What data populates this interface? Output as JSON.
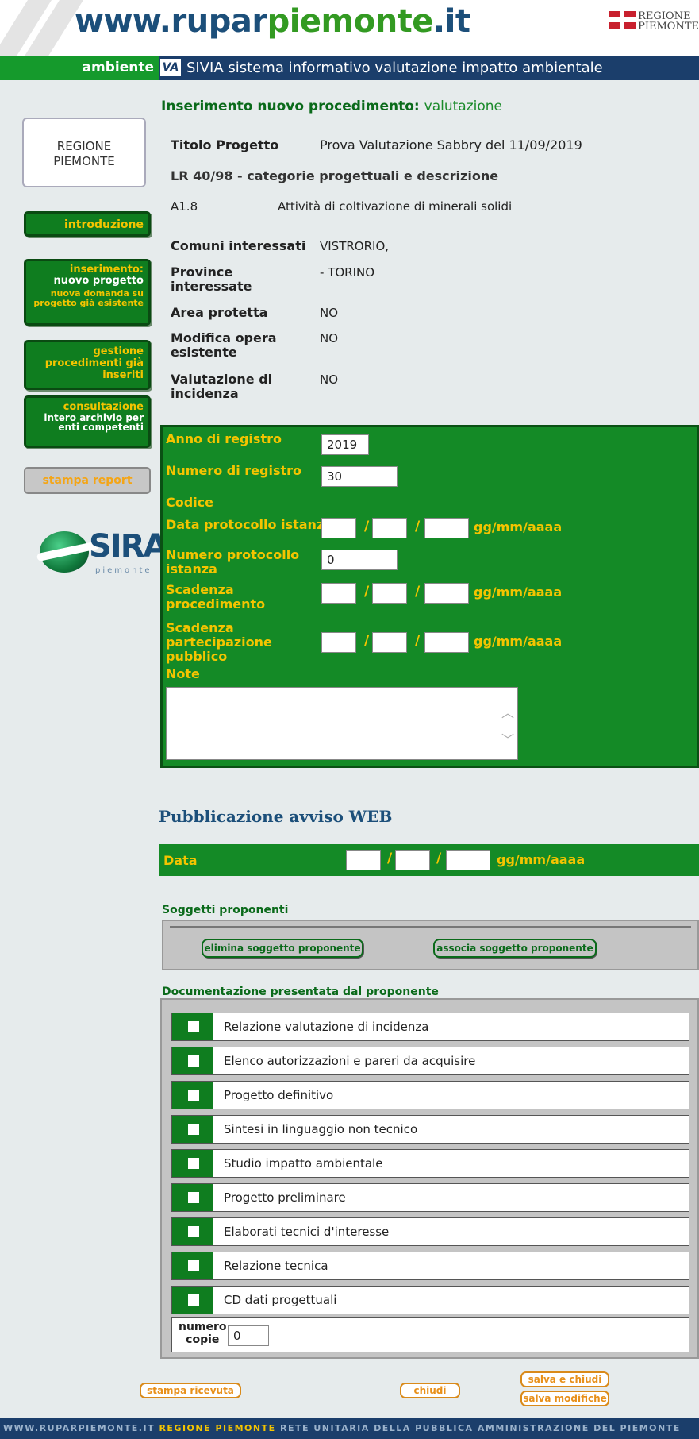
{
  "header": {
    "logo_pre": "www.",
    "logo_ru": "ru",
    "logo_par": "par",
    "logo_pie": "piemonte",
    "logo_post": ".it",
    "regione_line1": "REGIONE",
    "regione_line2": "PIEMONTE"
  },
  "nav": {
    "section": "ambiente",
    "via_logo": "VA",
    "title": "SIVIA sistema informativo valutazione impatto ambientale"
  },
  "sidebar": {
    "regione_line1": "REGIONE",
    "regione_line2": "PIEMONTE",
    "introduzione": "introduzione",
    "inserimento_title": "inserimento:",
    "inserimento_nuovo": "nuovo progetto",
    "inserimento_domanda": "nuova domanda su progetto già esistente",
    "gestione": "gestione procedimenti già inseriti",
    "consultazione_a": "consultazione",
    "consultazione_b": "intero archivio per enti competenti",
    "stampa": "stampa report",
    "sira": "SIRA",
    "sira_sub": "piemonte"
  },
  "main": {
    "heading": "Inserimento nuovo procedimento:",
    "heading_sub": "valutazione",
    "titolo_label": "Titolo Progetto",
    "titolo_value": "Prova Valutazione Sabbry del 11/09/2019",
    "lr_heading": "LR 40/98 - categorie progettuali e descrizione",
    "category_code": "A1.8",
    "category_desc": "Attività di coltivazione di minerali solidi",
    "comuni_label": "Comuni interessati",
    "comuni_value": "VISTRORIO,",
    "province_label_1": "Province",
    "province_label_2": "interessate",
    "province_value": "- TORINO",
    "area_label": "Area protetta",
    "area_value": "NO",
    "modifica_label_1": "Modifica opera",
    "modifica_label_2": "esistente",
    "modifica_value": "NO",
    "valutazione_label_1": "Valutazione di",
    "valutazione_label_2": "incidenza",
    "valutazione_value": "NO"
  },
  "registry": {
    "anno_label": "Anno di registro",
    "anno_value": "2019",
    "numero_label": "Numero di registro",
    "numero_value": "30",
    "codice_label": "Codice",
    "data_prot_label": "Data protocollo istanza",
    "date_format": "gg/mm/aaaa",
    "num_prot_label_1": "Numero protocollo",
    "num_prot_label_2": "istanza",
    "num_prot_value": "0",
    "scadenza_proc_1": "Scadenza",
    "scadenza_proc_2": "procedimento",
    "scadenza_part_1": "Scadenza",
    "scadenza_part_2": "partecipazione",
    "scadenza_part_3": "pubblico",
    "note_label": "Note",
    "slash": "/"
  },
  "web": {
    "heading": "Pubblicazione avviso WEB",
    "data_label": "Data"
  },
  "soggetti": {
    "title": "Soggetti proponenti",
    "elimina": "elimina soggetto proponente",
    "associa": "associa soggetto proponente"
  },
  "documentazione": {
    "title": "Documentazione presentata dal proponente",
    "items": [
      "Relazione valutazione di incidenza",
      "Elenco autorizzazioni e pareri da acquisire",
      "Progetto definitivo",
      "Sintesi in linguaggio non tecnico",
      "Studio impatto ambientale",
      "Progetto preliminare",
      "Elaborati tecnici d'interesse",
      "Relazione tecnica",
      "CD dati progettuali"
    ],
    "copie_label_1": "numero",
    "copie_label_2": "copie",
    "copie_value": "0"
  },
  "buttons": {
    "stampa_ricevuta": "stampa ricevuta",
    "chiudi": "chiudi",
    "salva_chiudi": "salva e chiudi",
    "salva_modifiche": "salva modifiche"
  },
  "footer": {
    "site": "WWW.RUPARPIEMONTE.IT",
    "regione": "REGIONE PIEMONTE",
    "rest": "RETE UNITARIA DELLA PUBBLICA AMMINISTRAZIONE DEL PIEMONTE"
  }
}
